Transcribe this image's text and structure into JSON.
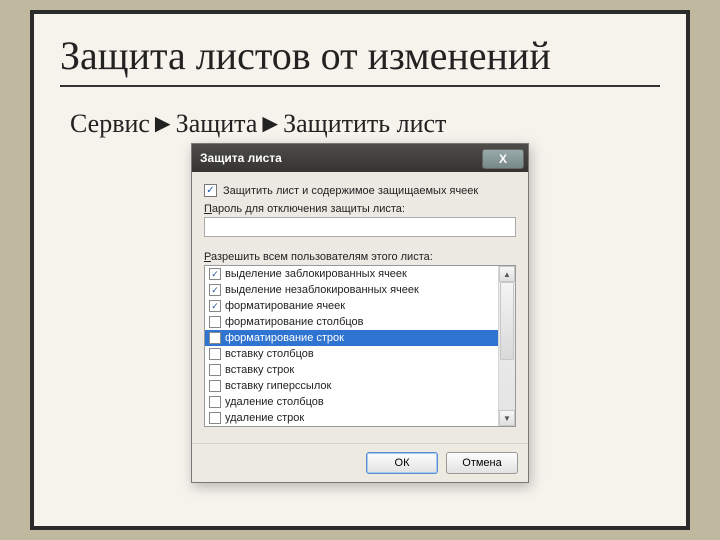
{
  "slide": {
    "title": "Защита листов от изменений",
    "path": "Сервис►Защита►Защитить лист"
  },
  "dialog": {
    "title": "Защита листа",
    "close_glyph": "X",
    "protect_label": "Защитить лист и содержимое защищаемых ячеек",
    "protect_checked": "✓",
    "password_label_1": "П",
    "password_label_2": "ароль для отключения защиты листа:",
    "password_value": "",
    "allow_label_1": "Р",
    "allow_label_2": "азрешить всем пользователям этого листа:",
    "items": [
      {
        "label": "выделение заблокированных ячеек",
        "checked": true,
        "selected": false
      },
      {
        "label": "выделение незаблокированных ячеек",
        "checked": true,
        "selected": false
      },
      {
        "label": "форматирование ячеек",
        "checked": true,
        "selected": false
      },
      {
        "label": "форматирование столбцов",
        "checked": false,
        "selected": false
      },
      {
        "label": "форматирование строк",
        "checked": false,
        "selected": true
      },
      {
        "label": "вставку столбцов",
        "checked": false,
        "selected": false
      },
      {
        "label": "вставку строк",
        "checked": false,
        "selected": false
      },
      {
        "label": "вставку гиперссылок",
        "checked": false,
        "selected": false
      },
      {
        "label": "удаление столбцов",
        "checked": false,
        "selected": false
      },
      {
        "label": "удаление строк",
        "checked": false,
        "selected": false
      }
    ],
    "scroll_up": "▲",
    "scroll_down": "▼",
    "ok_label": "ОК",
    "cancel_label": "Отмена"
  }
}
